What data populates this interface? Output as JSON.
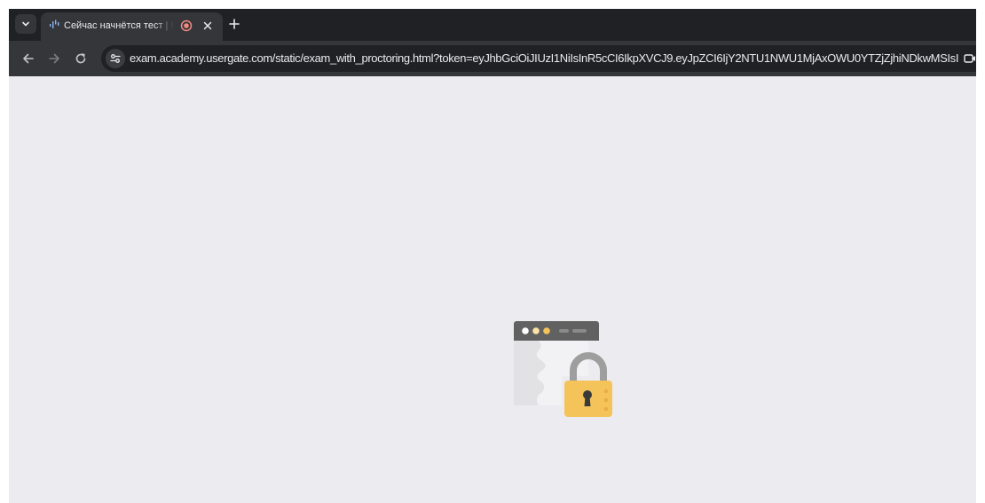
{
  "tab": {
    "title": "Сейчас начнётся тест | Exa"
  },
  "address_bar": {
    "url": "exam.academy.usergate.com/static/exam_with_proctoring.html?token=eyJhbGciOiJIUzI1NiIsInR5cCI6IkpXVCJ9.eyJpZCI6IjY2NTU1NWU1MjAxOWU0YTZjZjhiNDkwMSIsImhvc..."
  },
  "icons": {
    "tab_menu": "chevron-down-icon",
    "tab_audio": "audio-playing-icon",
    "tab_recording": "recording-icon",
    "tab_close": "close-icon",
    "new_tab": "plus-icon",
    "back": "arrow-left-icon",
    "forward": "arrow-right-icon",
    "reload": "reload-icon",
    "site_info": "tune-icon",
    "camera": "camera-icon",
    "lock": "padlock-icon"
  },
  "colors": {
    "tab_strip": "#202124",
    "toolbar": "#35363a",
    "content_bg": "#ececf0",
    "lock_body": "#f4c35a",
    "record_red": "#f28b82"
  }
}
